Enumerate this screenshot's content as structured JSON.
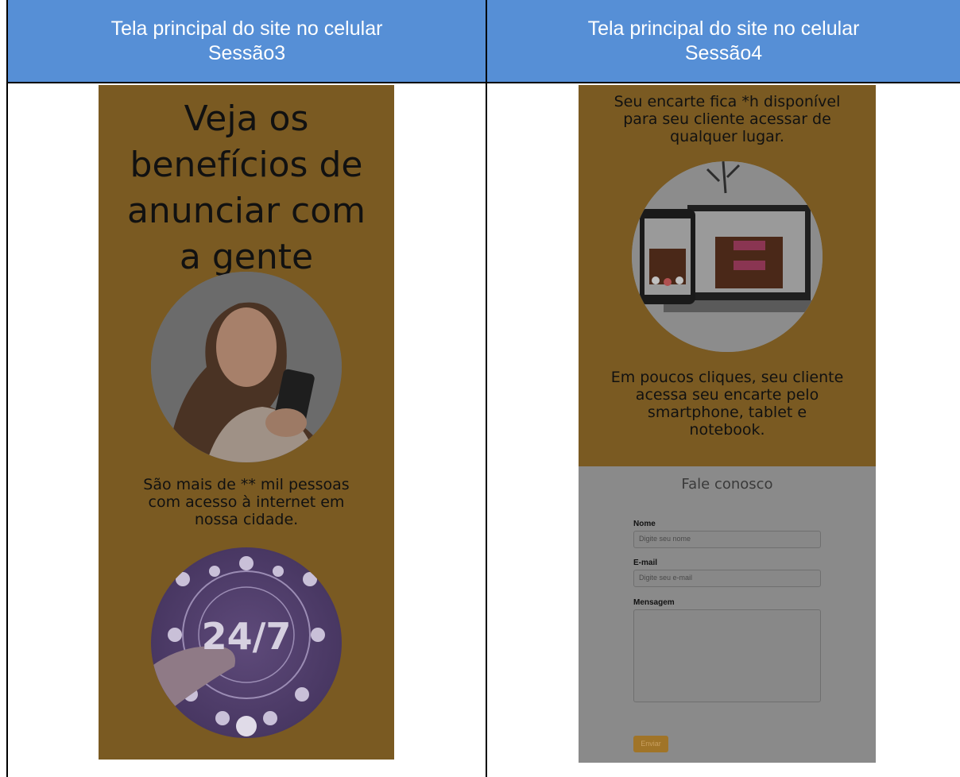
{
  "columns": [
    {
      "title_line1": "Tela principal do site no celular",
      "title_line2": "Sessão3"
    },
    {
      "title_line1": "Tela principal do site no celular",
      "title_line2": "Sessão4"
    }
  ],
  "section3": {
    "heading": [
      "Veja os",
      "benefícios de",
      "anunciar com",
      "a gente"
    ],
    "stat": [
      "São mais de ** mil pessoas",
      "com acesso à internet em",
      "nossa cidade."
    ],
    "badge_text": "24/7"
  },
  "section4": {
    "intro": [
      "Seu encarte fica *h disponível",
      "para seu cliente acessar de",
      "qualquer lugar."
    ],
    "devices": [
      "Em poucos cliques, seu cliente",
      "acessa seu encarte pelo",
      "smartphone, tablet e",
      "notebook."
    ],
    "contact": {
      "title": "Fale conosco",
      "name_label": "Nome",
      "name_placeholder": "Digite seu nome",
      "email_label": "E-mail",
      "email_placeholder": "Digite seu e-mail",
      "message_label": "Mensagem",
      "submit_label": "Enviar"
    }
  },
  "colors": {
    "header_blue": "#568fd6",
    "mustard_dimmed": "#7a5a22",
    "form_gray": "#8a8a8a"
  }
}
